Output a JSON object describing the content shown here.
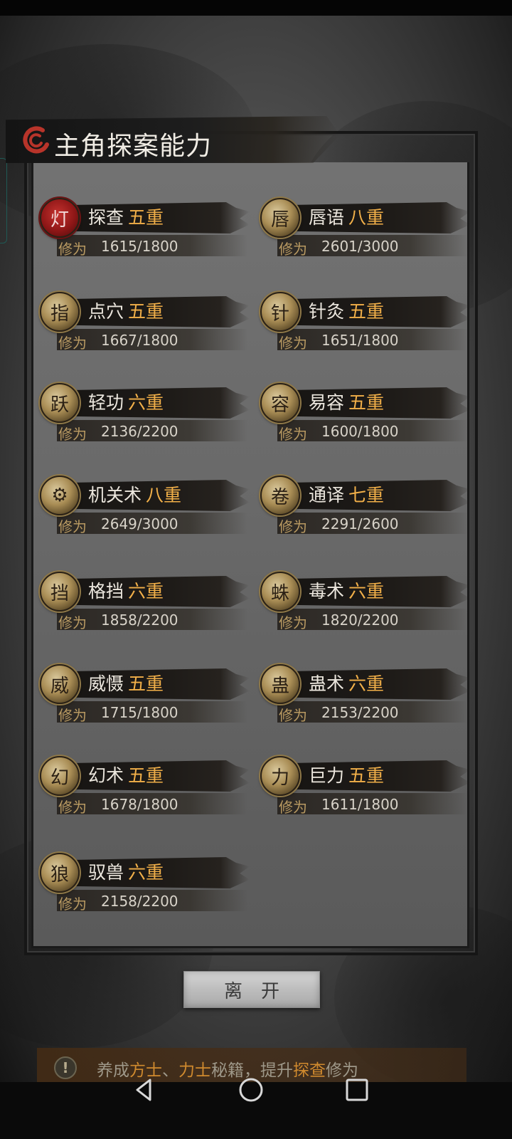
{
  "title": "主角探案能力",
  "cultivation_label": "修为",
  "skills": [
    {
      "name": "探查",
      "level": "五重",
      "value": "1615/1800",
      "icon": "red-lantern-icon"
    },
    {
      "name": "唇语",
      "level": "八重",
      "value": "2601/3000",
      "icon": "mask-face-icon"
    },
    {
      "name": "点穴",
      "level": "五重",
      "value": "1667/1800",
      "icon": "finger-strike-icon"
    },
    {
      "name": "针灸",
      "level": "五重",
      "value": "1651/1800",
      "icon": "needles-icon"
    },
    {
      "name": "轻功",
      "level": "六重",
      "value": "2136/2200",
      "icon": "leaping-figure-icon"
    },
    {
      "name": "易容",
      "level": "五重",
      "value": "1600/1800",
      "icon": "disguise-mask-icon"
    },
    {
      "name": "机关术",
      "level": "八重",
      "value": "2649/3000",
      "icon": "gear-mechanism-icon"
    },
    {
      "name": "通译",
      "level": "七重",
      "value": "2291/2600",
      "icon": "scroll-book-icon"
    },
    {
      "name": "格挡",
      "level": "六重",
      "value": "1858/2200",
      "icon": "block-shield-icon"
    },
    {
      "name": "毒术",
      "level": "六重",
      "value": "1820/2200",
      "icon": "spider-icon"
    },
    {
      "name": "威慑",
      "level": "五重",
      "value": "1715/1800",
      "icon": "intimidate-figure-icon"
    },
    {
      "name": "蛊术",
      "level": "六重",
      "value": "2153/2200",
      "icon": "gu-worm-icon"
    },
    {
      "name": "幻术",
      "level": "五重",
      "value": "1678/1800",
      "icon": "illusion-monk-icon"
    },
    {
      "name": "巨力",
      "level": "五重",
      "value": "1611/1800",
      "icon": "strong-man-icon"
    },
    {
      "name": "驭兽",
      "level": "六重",
      "value": "2158/2200",
      "icon": "wolf-icon"
    }
  ],
  "leave_button": "离开",
  "tip": {
    "parts": [
      "养成",
      "方士",
      "、",
      "力士",
      "秘籍，提升",
      "探查",
      "修为"
    ],
    "highlight": [
      false,
      true,
      false,
      true,
      false,
      true,
      false
    ]
  },
  "colors": {
    "level": "#f2b049",
    "label": "#b99a62",
    "tip_highlight": "#d08a2e"
  }
}
